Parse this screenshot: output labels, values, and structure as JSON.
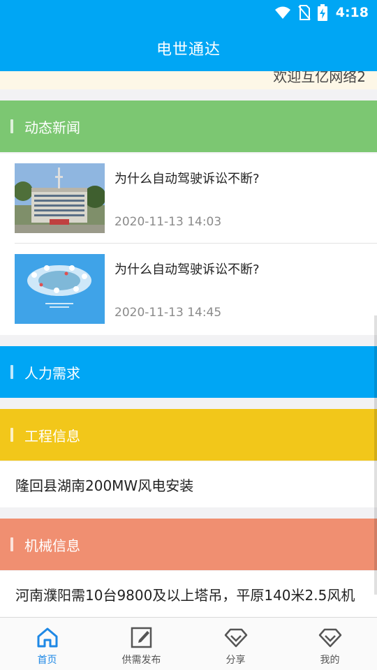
{
  "status_bar": {
    "time": "4:18"
  },
  "app": {
    "title": "电世通达"
  },
  "marquee": {
    "text": "欢迎互亿网络2"
  },
  "sections": {
    "news": {
      "title": "动态新闻",
      "color": "#7cc772"
    },
    "hr": {
      "title": "人力需求",
      "color": "#00a6f4"
    },
    "engineering": {
      "title": "工程信息",
      "color": "#f2c71a"
    },
    "machinery": {
      "title": "机械信息",
      "color": "#f08f71"
    }
  },
  "news_items": [
    {
      "title": "为什么自动驾驶诉讼不断?",
      "date": "2020-11-13 14:03",
      "thumb": "building-photo"
    },
    {
      "title": "为什么自动驾驶诉讼不断?",
      "date": "2020-11-13 14:45",
      "thumb": "globe-network-graphic"
    }
  ],
  "engineering_items": [
    {
      "text": "隆回县湖南200MW风电安装"
    }
  ],
  "machinery_items": [
    {
      "text": "河南濮阳需10台9800及以上塔吊，平原140米2.5风机"
    }
  ],
  "tabs": [
    {
      "label": "首页",
      "icon": "home-icon",
      "active": true
    },
    {
      "label": "供需发布",
      "icon": "edit-icon",
      "active": false
    },
    {
      "label": "分享",
      "icon": "diamond-icon",
      "active": false
    },
    {
      "label": "我的",
      "icon": "diamond-icon",
      "active": false
    }
  ],
  "colors": {
    "accent": "#00a6f4",
    "tab_active": "#1e88e5"
  }
}
